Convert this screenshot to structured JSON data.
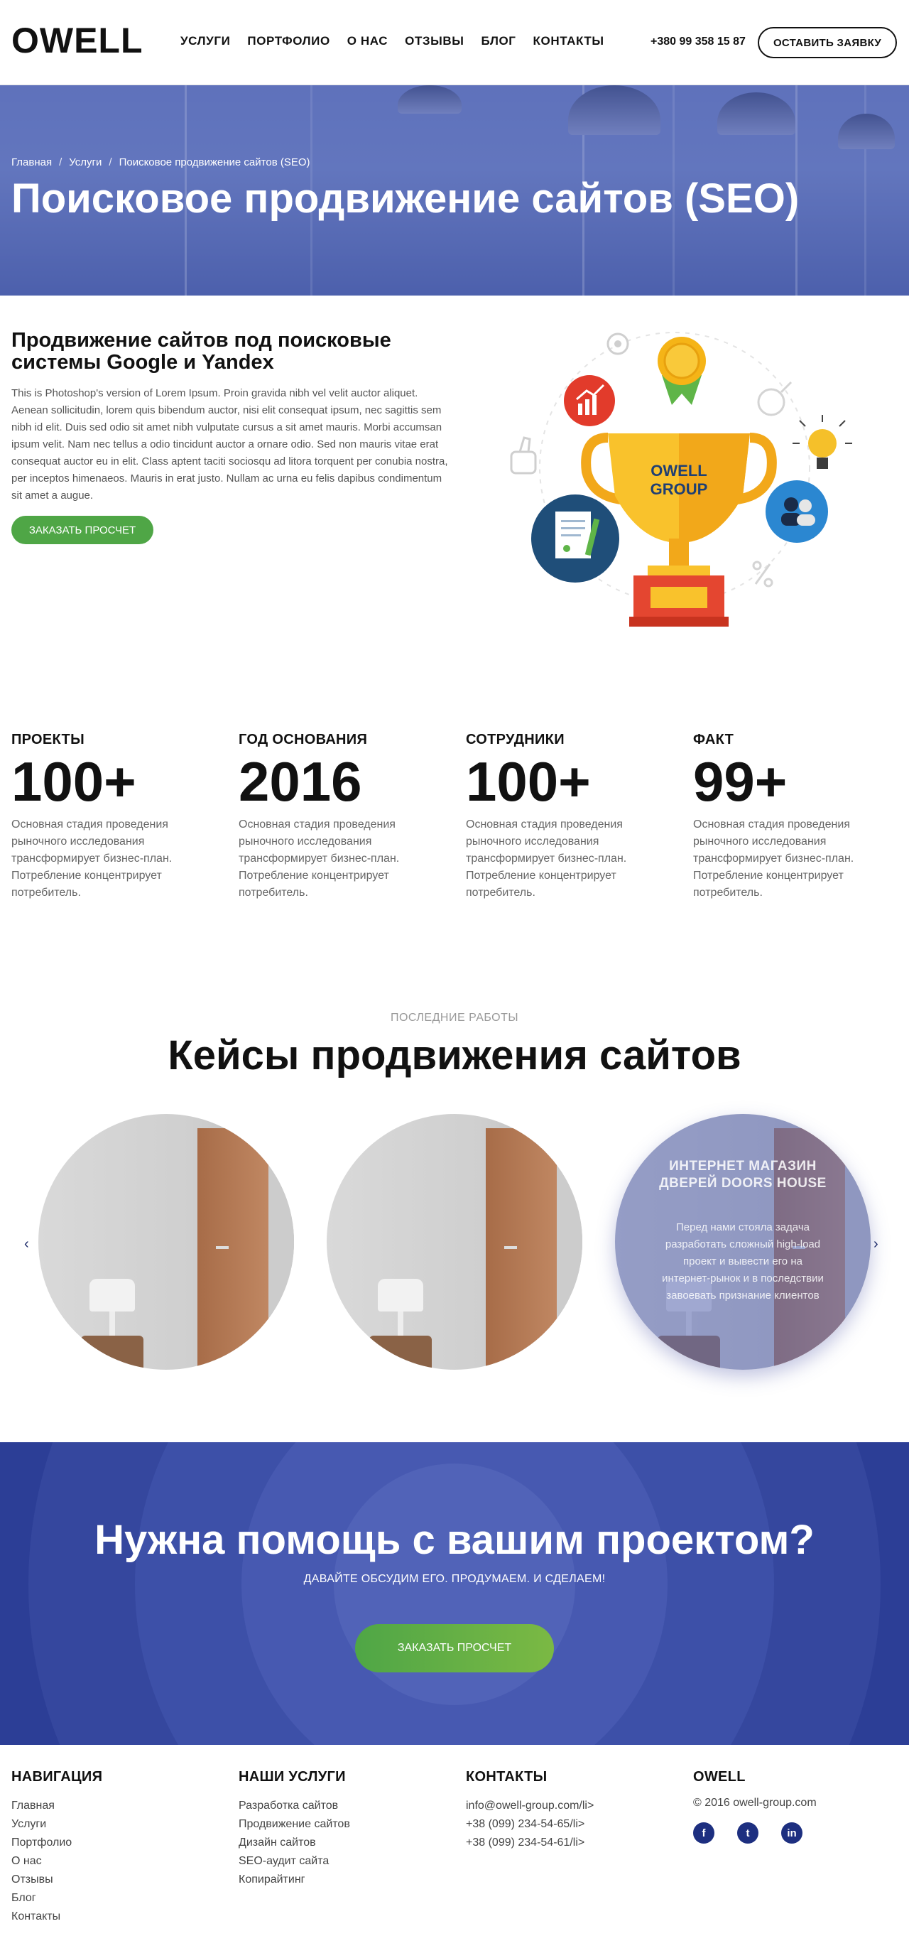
{
  "header": {
    "logo": "OWELL",
    "nav": [
      "УСЛУГИ",
      "ПОРТФОЛИО",
      "О НАС",
      "ОТЗЫВЫ",
      "БЛОГ",
      "КОНТАКТЫ"
    ],
    "phone": "+380 99 358 15 87",
    "cta_label": "ОСТАВИТЬ ЗАЯВКУ"
  },
  "hero": {
    "breadcrumbs": [
      "Главная",
      "Услуги",
      "Поисковое продвижение сайтов (SEO)"
    ],
    "separator": "/",
    "title": "Поисковое продвижение сайтов (SEO)"
  },
  "intro": {
    "title": "Продвижение сайтов под поисковые системы Google и Yandex",
    "text": "This is Photoshop's version of Lorem Ipsum. Proin gravida nibh vel velit auctor aliquet. Aenean sollicitudin, lorem quis bibendum auctor, nisi elit consequat ipsum, nec sagittis sem nibh id elit. Duis sed odio sit amet nibh vulputate cursus a sit amet mauris. Morbi accumsan ipsum velit. Nam nec tellus a odio tincidunt auctor a ornare odio. Sed non mauris vitae erat consequat auctor eu in elit. Class aptent taciti sociosqu ad litora torquent per conubia nostra, per inceptos himenaeos. Mauris in erat justo. Nullam ac urna eu felis dapibus condimentum sit amet a augue.",
    "button_label": "ЗАКАЗАТЬ ПРОСЧЕТ",
    "trophy_label": [
      "OWELL",
      "GROUP"
    ]
  },
  "stats": [
    {
      "label": "ПРОЕКТЫ",
      "value": "100+",
      "desc": "Основная стадия проведения рыночного исследования трансформирует бизнес-план. Потребление концентрирует потребитель."
    },
    {
      "label": "ГОД ОСНОВАНИЯ",
      "value": "2016",
      "desc": "Основная стадия проведения рыночного исследования трансформирует бизнес-план. Потребление концентрирует потребитель."
    },
    {
      "label": "СОТРУДНИКИ",
      "value": "100+",
      "desc": "Основная стадия проведения рыночного исследования трансформирует бизнес-план. Потребление концентрирует потребитель."
    },
    {
      "label": "ФАКТ",
      "value": "99+",
      "desc": "Основная стадия проведения рыночного исследования трансформирует бизнес-план. Потребление концентрирует потребитель."
    }
  ],
  "cases": {
    "kicker": "ПОСЛЕДНИЕ РАБОТЫ",
    "title": "Кейсы продвижения сайтов",
    "featured": {
      "title": "ИНТЕРНЕТ МАГАЗИН ДВЕРЕЙ DOORS HOUSE",
      "text": "Перед нами стояла задача разработать сложный high-load проект и вывести его на интернет-рынок и в последствии завоевать признание клиентов"
    },
    "arrow_prev": "‹",
    "arrow_next": "›"
  },
  "cta": {
    "title": "Нужна помощь с вашим проектом?",
    "subtitle": "ДАВАЙТЕ ОБСУДИМ ЕГО. ПРОДУМАЕМ. И СДЕЛАЕМ!",
    "button_label": "ЗАКАЗАТЬ ПРОСЧЕТ"
  },
  "footer": {
    "nav_title": "НАВИГАЦИЯ",
    "nav_items": [
      "Главная",
      "Услуги",
      "Портфолио",
      "О нас",
      "Отзывы",
      "Блог",
      "Контакты"
    ],
    "services_title": "НАШИ УСЛУГИ",
    "services_items": [
      "Разработка сайтов",
      "Продвижение сайтов",
      "Дизайн сайтов",
      "SEO-аудит сайта",
      "Копирайтинг"
    ],
    "contacts_title": "КОНТАКТЫ",
    "contacts_items": [
      "info@owell-group.com/li>",
      "+38 (099) 234-54-65/li>",
      "+38 (099) 234-54-61/li>"
    ],
    "brand_title": "OWELL",
    "copyright": "© 2016 owell-group.com",
    "socials": [
      "f",
      "t",
      "in"
    ]
  },
  "colors": {
    "accent_green": "#4fa646",
    "cta_blue": "#2c3e96",
    "social_blue": "#1d2f80"
  },
  "icons": [
    "trophy-icon",
    "medal-icon",
    "chart-icon",
    "document-icon",
    "lightbulb-icon",
    "users-icon",
    "thumbs-up-icon",
    "gear-icon",
    "gender-icon",
    "percent-icon",
    "facebook-icon",
    "twitter-icon",
    "linkedin-icon",
    "chevron-left-icon",
    "chevron-right-icon"
  ]
}
